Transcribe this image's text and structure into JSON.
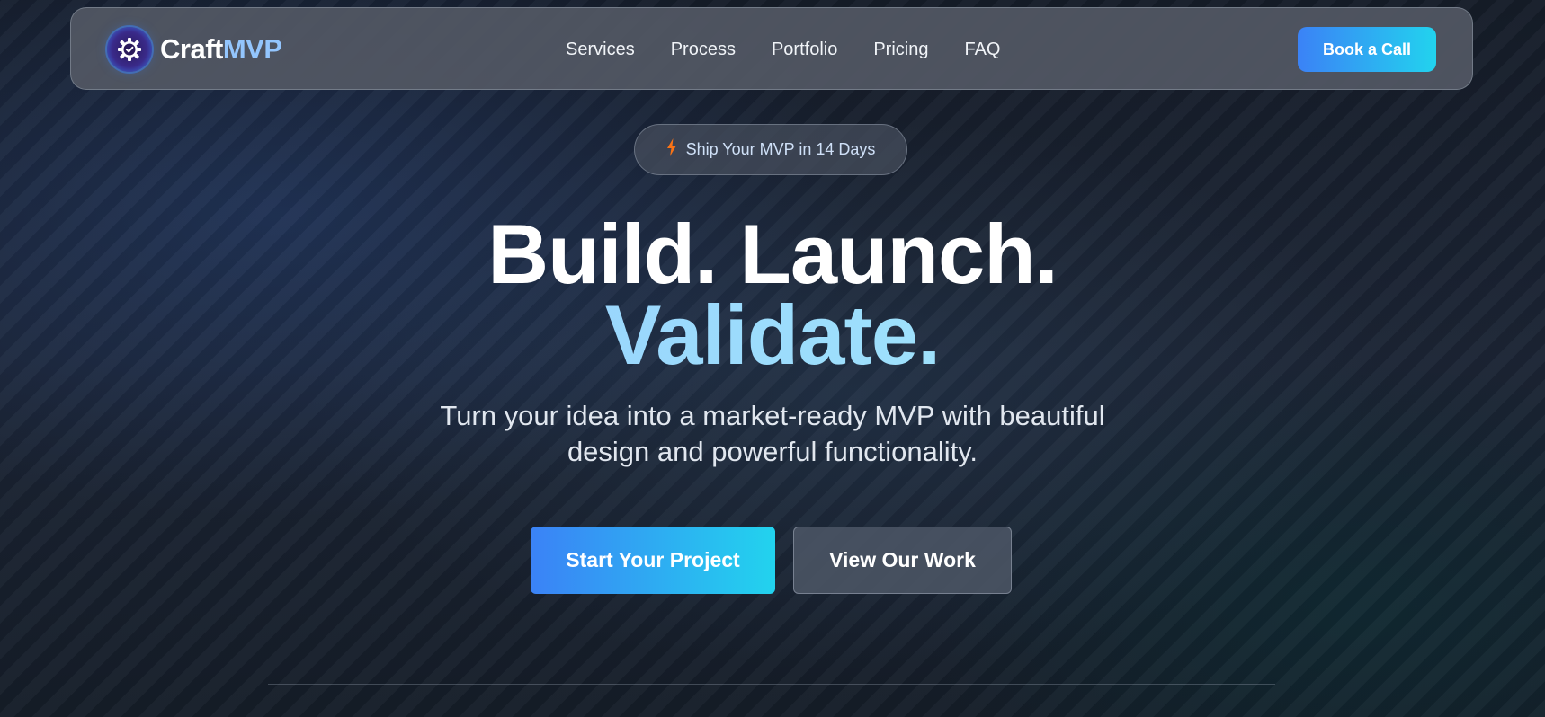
{
  "brand": {
    "name_primary": "Craft",
    "name_accent": "MVP",
    "logo_icon": "gear-clock-icon"
  },
  "nav": {
    "links": [
      "Services",
      "Process",
      "Portfolio",
      "Pricing",
      "FAQ"
    ],
    "cta": "Book a Call"
  },
  "badge": {
    "icon": "lightning-icon",
    "text": "Ship Your MVP in 14 Days"
  },
  "hero": {
    "headline_line1": "Build. Launch.",
    "headline_line2": "Validate.",
    "subtitle_line1": "Turn your idea into a market-ready MVP with beautiful",
    "subtitle_line2": "design and powerful functionality.",
    "primary_cta": "Start Your Project",
    "secondary_cta": "View Our Work"
  },
  "colors": {
    "accent_start": "#3b82f6",
    "accent_end": "#22d3ee",
    "accent_text": "#93c5fd",
    "bolt": "#f97316"
  }
}
